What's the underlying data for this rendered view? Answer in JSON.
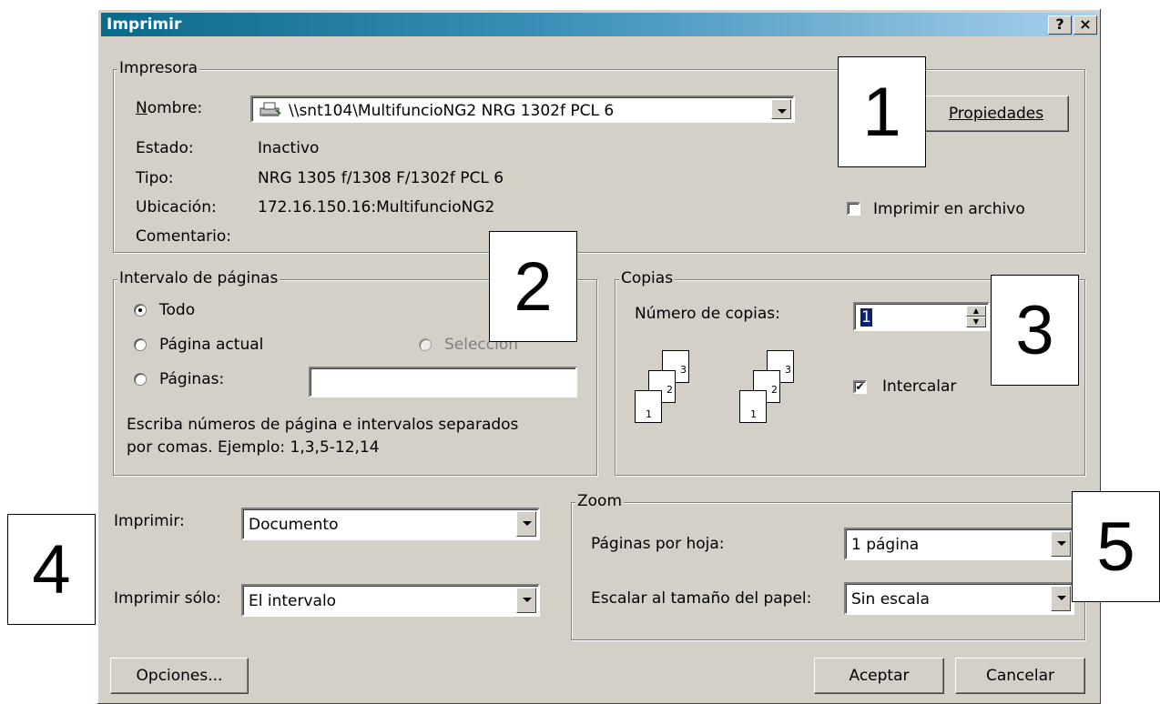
{
  "title": "Imprimir",
  "titlebar_buttons": {
    "help": "?",
    "close": "×"
  },
  "printer": {
    "group_label": "Impresora",
    "name_label": "Nombre:",
    "name_value": "\\\\snt104\\MultifuncioNG2 NRG 1302f PCL 6",
    "printer_icon": "printer-icon",
    "properties_button": "Propiedades",
    "status_label": "Estado:",
    "status_value": "Inactivo",
    "type_label": "Tipo:",
    "type_value": "NRG 1305 f/1308 F/1302f PCL 6",
    "location_label": "Ubicación:",
    "location_value": "172.16.150.16:MultifuncioNG2",
    "comment_label": "Comentario:",
    "print_to_file": "Imprimir en archivo"
  },
  "page_range": {
    "group_label": "Intervalo de páginas",
    "all": "Todo",
    "current": "Página actual",
    "selection": "Selección",
    "pages": "Páginas:",
    "pages_value": "",
    "hint_line1": "Escriba números de página e intervalos separados",
    "hint_line2": "por comas. Ejemplo: 1,3,5-12,14"
  },
  "copies": {
    "group_label": "Copias",
    "number_label": "Número de copias:",
    "number_value": "1",
    "collate": "Intercalar",
    "collate_checked": true,
    "page_numbers": [
      "1",
      "2",
      "3"
    ]
  },
  "print_what": {
    "label": "Imprimir:",
    "value": "Documento",
    "only_label": "Imprimir sólo:",
    "only_value": "El intervalo"
  },
  "zoom": {
    "group_label": "Zoom",
    "pages_per_sheet_label": "Páginas por hoja:",
    "pages_per_sheet_value": "1 página",
    "scale_label": "Escalar al tamaño del papel:",
    "scale_value": "Sin escala"
  },
  "footer": {
    "options": "Opciones...",
    "ok": "Aceptar",
    "cancel": "Cancelar"
  },
  "callouts": [
    "1",
    "2",
    "3",
    "4",
    "5"
  ]
}
